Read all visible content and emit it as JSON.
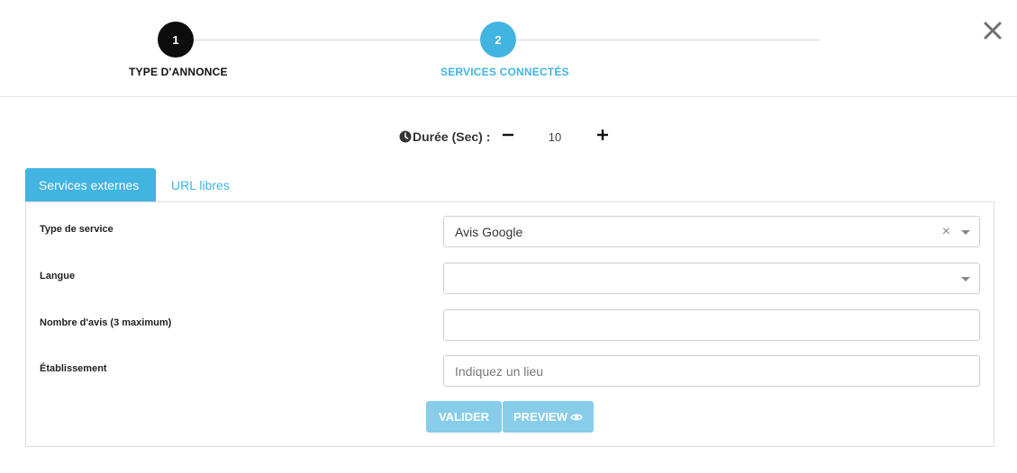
{
  "stepper": {
    "steps": [
      {
        "number": "1",
        "label": "TYPE D'ANNONCE",
        "state": "done"
      },
      {
        "number": "2",
        "label": "SERVICES CONNECTÉS",
        "state": "active"
      }
    ],
    "close_icon": "close-icon"
  },
  "duration": {
    "label": "Durée (Sec) :",
    "value": "10",
    "icons": {
      "clock": "clock-icon",
      "minus": "minus-icon",
      "plus": "plus-icon"
    }
  },
  "tabs": [
    {
      "label": "Services externes",
      "active": true
    },
    {
      "label": "URL libres",
      "active": false
    }
  ],
  "form": {
    "service_type": {
      "label": "Type de service",
      "value": "Avis Google"
    },
    "language": {
      "label": "Langue",
      "value": ""
    },
    "review_count": {
      "label": "Nombre d'avis (3 maximum)",
      "value": ""
    },
    "establishment": {
      "label": "Établissement",
      "placeholder": "Indiquez un lieu"
    }
  },
  "buttons": {
    "validate": "VALIDER",
    "preview": "PREVIEW"
  },
  "colors": {
    "accent": "#41b4e2",
    "button_disabled": "#87cdea",
    "step_done": "#0d0d0d"
  }
}
